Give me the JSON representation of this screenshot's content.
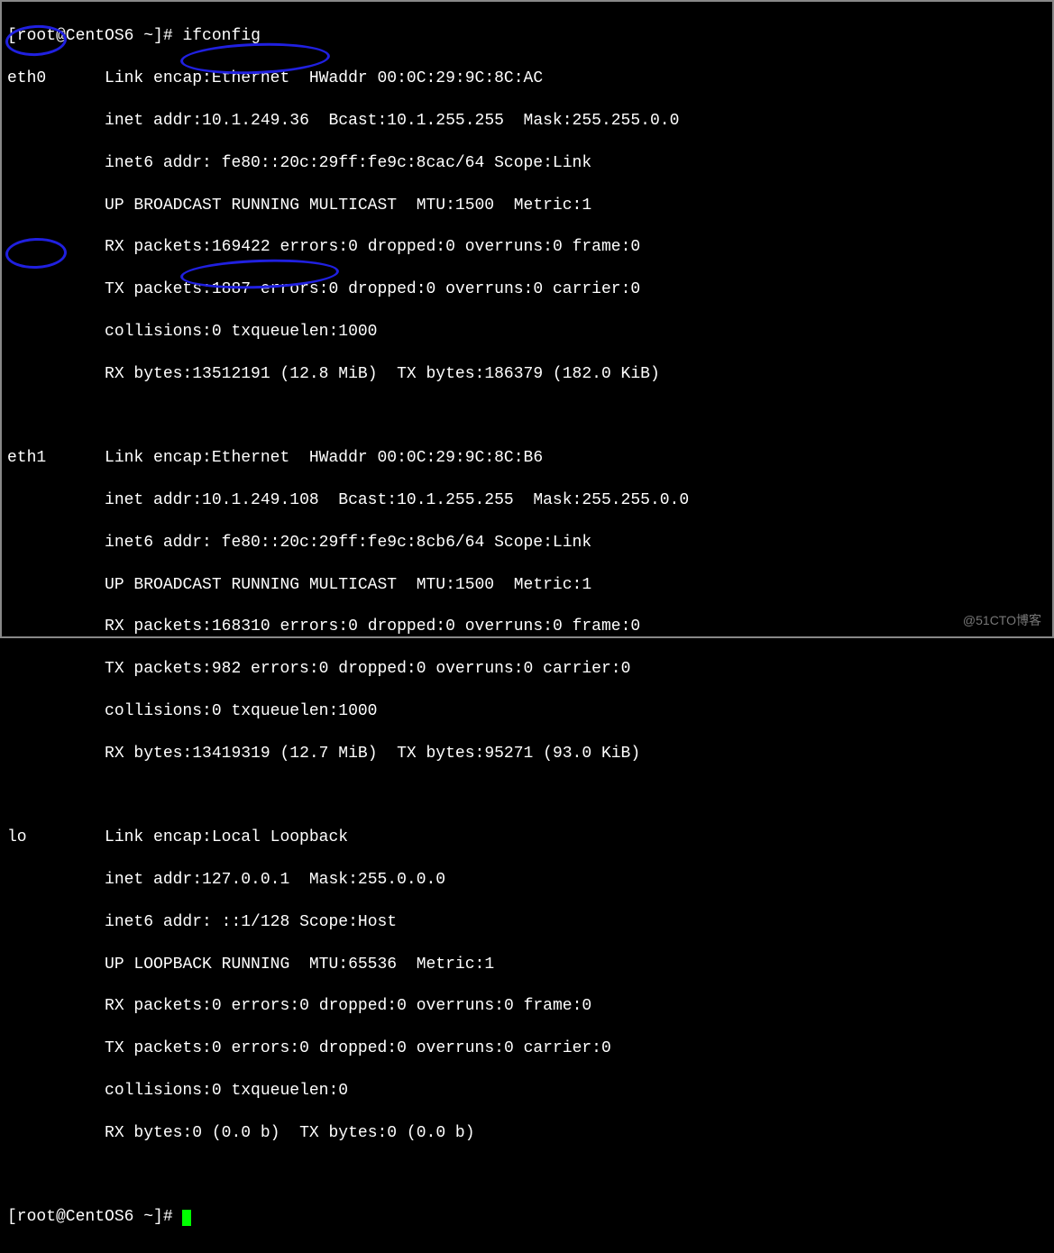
{
  "prompt": "[root@CentOS6 ~]#",
  "command": "ifconfig",
  "watermark": "@51CTO博客",
  "interfaces": [
    {
      "name": "eth0",
      "link_encap": "Ethernet",
      "hwaddr": "00:0C:29:9C:8C:AC",
      "inet_addr": "10.1.249.36",
      "bcast": "10.1.255.255",
      "mask": "255.255.0.0",
      "inet6_addr": "fe80::20c:29ff:fe9c:8cac/64",
      "inet6_scope": "Link",
      "flags": "UP BROADCAST RUNNING MULTICAST",
      "mtu": "1500",
      "metric": "1",
      "rx_packets": "169422",
      "rx_errors": "0",
      "rx_dropped": "0",
      "rx_overruns": "0",
      "rx_frame": "0",
      "tx_packets": "1887",
      "tx_errors": "0",
      "tx_dropped": "0",
      "tx_overruns": "0",
      "tx_carrier": "0",
      "collisions": "0",
      "txqueuelen": "1000",
      "rx_bytes": "13512191",
      "rx_bytes_h": "12.8 MiB",
      "tx_bytes": "186379",
      "tx_bytes_h": "182.0 KiB"
    },
    {
      "name": "eth1",
      "link_encap": "Ethernet",
      "hwaddr": "00:0C:29:9C:8C:B6",
      "inet_addr": "10.1.249.108",
      "bcast": "10.1.255.255",
      "mask": "255.255.0.0",
      "inet6_addr": "fe80::20c:29ff:fe9c:8cb6/64",
      "inet6_scope": "Link",
      "flags": "UP BROADCAST RUNNING MULTICAST",
      "mtu": "1500",
      "metric": "1",
      "rx_packets": "168310",
      "rx_errors": "0",
      "rx_dropped": "0",
      "rx_overruns": "0",
      "rx_frame": "0",
      "tx_packets": "982",
      "tx_errors": "0",
      "tx_dropped": "0",
      "tx_overruns": "0",
      "tx_carrier": "0",
      "collisions": "0",
      "txqueuelen": "1000",
      "rx_bytes": "13419319",
      "rx_bytes_h": "12.7 MiB",
      "tx_bytes": "95271",
      "tx_bytes_h": "93.0 KiB"
    },
    {
      "name": "lo",
      "link_encap": "Local Loopback",
      "hwaddr": "",
      "inet_addr": "127.0.0.1",
      "bcast": "",
      "mask": "255.0.0.0",
      "inet6_addr": "::1/128",
      "inet6_scope": "Host",
      "flags": "UP LOOPBACK RUNNING",
      "mtu": "65536",
      "metric": "1",
      "rx_packets": "0",
      "rx_errors": "0",
      "rx_dropped": "0",
      "rx_overruns": "0",
      "rx_frame": "0",
      "tx_packets": "0",
      "tx_errors": "0",
      "tx_dropped": "0",
      "tx_overruns": "0",
      "tx_carrier": "0",
      "collisions": "0",
      "txqueuelen": "0",
      "rx_bytes": "0",
      "rx_bytes_h": "0.0 b",
      "tx_bytes": "0",
      "tx_bytes_h": "0.0 b"
    }
  ]
}
